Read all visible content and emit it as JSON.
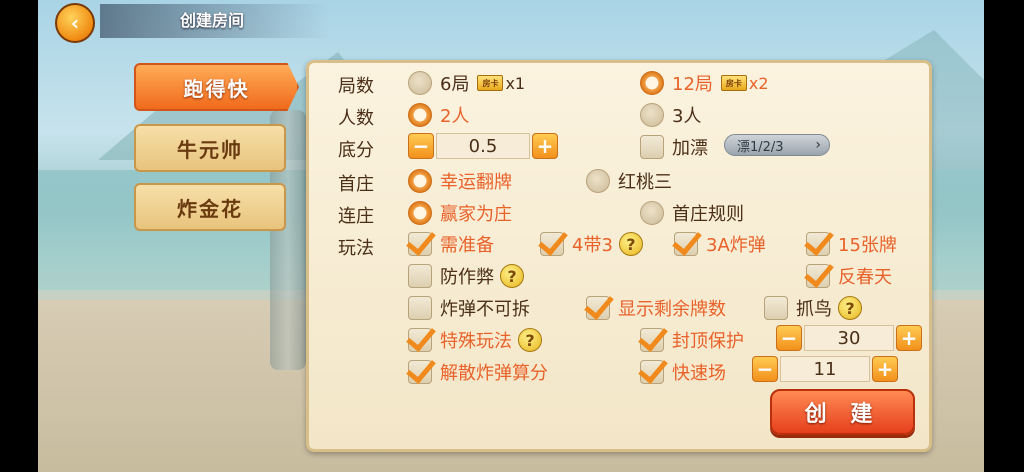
{
  "header": {
    "title": "创建房间"
  },
  "tabs": [
    {
      "label": "跑得快",
      "active": true
    },
    {
      "label": "牛元帅",
      "active": false
    },
    {
      "label": "炸金花",
      "active": false
    }
  ],
  "rows": {
    "jushu": {
      "label": "局数",
      "opt1": "6局",
      "opt1_mult": "x1",
      "opt2": "12局",
      "opt2_mult": "x2",
      "ticket": "房卡",
      "selected": "12局"
    },
    "renshu": {
      "label": "人数",
      "opt1": "2人",
      "opt2": "3人",
      "selected": "2人"
    },
    "difen": {
      "label": "底分",
      "value": "0.5",
      "minus": "−",
      "plus": "+",
      "piao_label": "加漂",
      "piao_options": "漂1/2/3",
      "piao_chev": "›"
    },
    "shouzhuang": {
      "label": "首庄",
      "opt1": "幸运翻牌",
      "opt2": "红桃三",
      "selected": "幸运翻牌"
    },
    "lianzhuang": {
      "label": "连庄",
      "opt1": "赢家为庄",
      "opt2": "首庄规则",
      "selected": "赢家为庄"
    },
    "wanfa": {
      "label": "玩法",
      "xuzhunbei": "需准备",
      "sidai3": "4带3",
      "san_a_zhadan": "3A炸弹",
      "shiwu_zhang": "15张牌",
      "fangzuobi": "防作弊",
      "fanchuntian": "反春天",
      "zhadan_bukechai": "炸弹不可拆",
      "xianshi_shengyu": "显示剩余牌数",
      "zhuaniao": "抓鸟",
      "teshu_wanfa": "特殊玩法",
      "fengding_baohu": "封顶保护",
      "fengding_value": "30",
      "jiesan_zhadan": "解散炸弹算分",
      "kuaisuchang": "快速场",
      "kuaisuchang_value": "11",
      "help": "?"
    }
  },
  "create_button": "创 建",
  "back_icon": "‹"
}
